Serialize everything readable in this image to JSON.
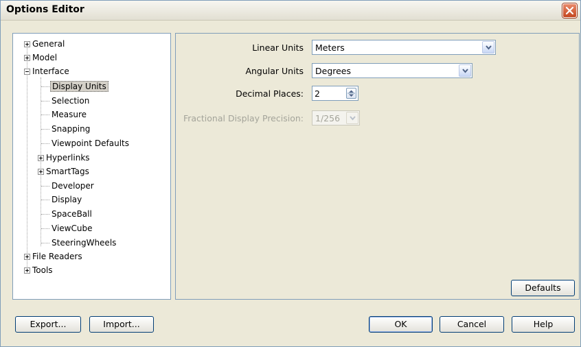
{
  "window": {
    "title": "Options Editor"
  },
  "tree": {
    "items": [
      {
        "label": "General"
      },
      {
        "label": "Model"
      },
      {
        "label": "Interface"
      },
      {
        "label": "Display Units"
      },
      {
        "label": "Selection"
      },
      {
        "label": "Measure"
      },
      {
        "label": "Snapping"
      },
      {
        "label": "Viewpoint Defaults"
      },
      {
        "label": "Hyperlinks"
      },
      {
        "label": "SmartTags"
      },
      {
        "label": "Developer"
      },
      {
        "label": "Display"
      },
      {
        "label": "SpaceBall"
      },
      {
        "label": "ViewCube"
      },
      {
        "label": "SteeringWheels"
      },
      {
        "label": "File Readers"
      },
      {
        "label": "Tools"
      }
    ]
  },
  "settings": {
    "linear_units": {
      "label": "Linear Units",
      "value": "Meters"
    },
    "angular_units": {
      "label": "Angular Units",
      "value": "Degrees"
    },
    "decimal_places": {
      "label": "Decimal Places:",
      "value": "2"
    },
    "fractional_precision": {
      "label": "Fractional Display Precision:",
      "value": "1/256"
    },
    "defaults_label": "Defaults"
  },
  "footer": {
    "export_label": "Export...",
    "import_label": "Import...",
    "ok_label": "OK",
    "cancel_label": "Cancel",
    "help_label": "Help"
  },
  "colors": {
    "close_button": "#c3461f",
    "window_bg": "#ece9d8",
    "border": "#7f9db9"
  }
}
